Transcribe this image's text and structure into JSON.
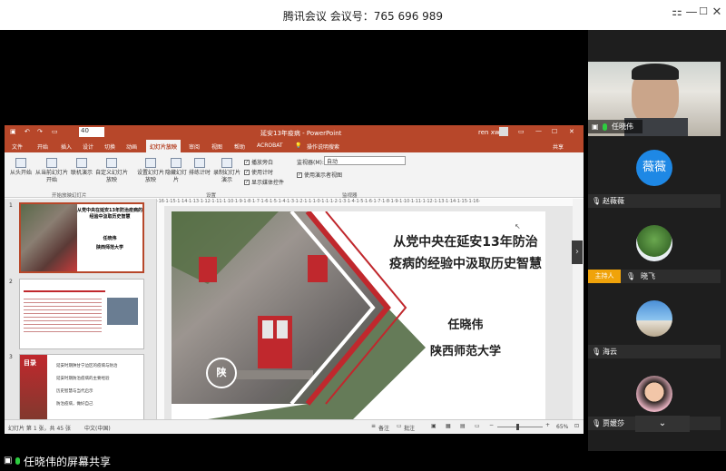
{
  "window": {
    "title": "腾讯会议 会议号：765 696 989",
    "controls": [
      "⚏",
      "—",
      "☐",
      "✕"
    ]
  },
  "ppt": {
    "doc_title": "延安13年疫病 - PowerPoint",
    "user": "ren xw",
    "zoom_box": "40",
    "tabs": [
      "文件",
      "开始",
      "插入",
      "设计",
      "切换",
      "动画",
      "幻灯片放映",
      "审阅",
      "视图",
      "帮助",
      "ACROBAT",
      "操作说明搜索"
    ],
    "share_label": "共享",
    "ribbon": {
      "from_start": "从头开始",
      "from_current": "从当前幻灯片开始",
      "online": "联机演示",
      "custom": "自定义幻灯片放映",
      "setup": "设置幻灯片放映",
      "hide": "隐藏幻灯片",
      "rehearse": "排练计时",
      "record": "录制幻灯片演示",
      "play_narration": "播放旁白",
      "use_timing": "使用计时",
      "show_media": "显示媒体控件",
      "monitor_label": "监视器(M):",
      "monitor_value": "自动",
      "presenter_view": "使用演示者视图",
      "group_start": "开始放映幻灯片",
      "group_setup": "设置",
      "group_monitor": "监视器"
    },
    "thumbs": [
      {
        "num": "1",
        "title": "从党中央在延安13年防治疫病的经验中汲取历史智慧",
        "author": "任晓伟",
        "org": "陕西师范大学"
      },
      {
        "num": "2"
      },
      {
        "num": "3",
        "heading": "目录",
        "items": [
          "延安时期陕甘宁边区的疫病与防治",
          "延安时期防治疫病的主要经验",
          "历史智慧与当代启示",
          "防治疫病，做好自己"
        ]
      }
    ],
    "ruler": "·16·1·15·1·14·1·13·1·12·1·11·1·10·1·9·1·8·1·7·1·6·1·5·1·4·1·3·1·2·1·1·1·0·1·1·1·2·1·3·1·4·1·5·1·6·1·7·1·8·1·9·1·10·1·11·1·12·1·13·1·14·1·15·1·16·",
    "slide": {
      "title_line1": "从党中央在延安13年防治",
      "title_line2": "疫病的经验中汲取历史智慧",
      "author": "任晓伟",
      "org": "陕西师范大学",
      "seal_char": "陕"
    },
    "status": {
      "slide_info": "幻灯片 第 1 张，共 45 张",
      "lang": "中文(中国)",
      "notes": "备注",
      "comments": "批注",
      "zoom": "65%"
    }
  },
  "participants": [
    {
      "name": "任晓伟",
      "role": ""
    },
    {
      "name": "赵薇薇",
      "avatar_text": "薇薇",
      "role": ""
    },
    {
      "name": "晓飞",
      "role": "主持人"
    },
    {
      "name": "海云",
      "role": ""
    },
    {
      "name": "贾媛莎",
      "role": ""
    }
  ],
  "share_banner": "任晓伟的屏幕共享",
  "colors": {
    "ppt_accent": "#b7472a",
    "slide_red": "#c0282d",
    "mic_green": "#2ecc40",
    "host_badge": "#f0a30a",
    "avatar_blue": "#1e88e5"
  }
}
